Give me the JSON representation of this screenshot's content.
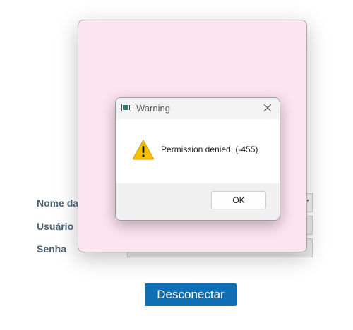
{
  "form": {
    "name_label": "Nome da V",
    "user_label": "Usuário",
    "password_label": "Senha"
  },
  "disconnect_label": "Desconectar",
  "dialog": {
    "title": "Warning",
    "message": "Permission denied. (-455)",
    "ok_label": "OK",
    "icons": {
      "app": "app-window-icon",
      "warning": "warning-triangle-icon",
      "close": "close-icon"
    }
  },
  "colors": {
    "button_blue": "#0e6fb5",
    "pink_window": "#fce4f1",
    "label_text": "#4a6276",
    "warning_yellow": "#f5c000"
  }
}
